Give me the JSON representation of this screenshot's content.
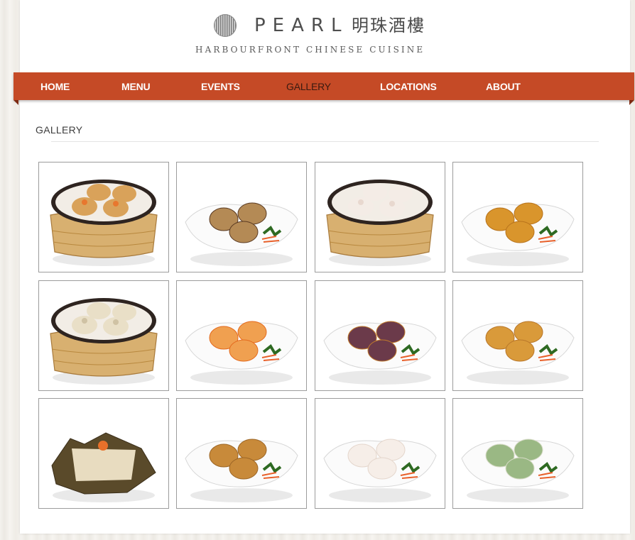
{
  "logo": {
    "name": "PEARL",
    "chinese_name": "明珠酒樓",
    "tagline": "HARBOURFRONT CHINESE CUISINE"
  },
  "nav": {
    "items": [
      {
        "label": "HOME"
      },
      {
        "label": "MENU"
      },
      {
        "label": "EVENTS"
      },
      {
        "label": "GALLERY",
        "active": true
      },
      {
        "label": "LOCATIONS"
      },
      {
        "label": "ABOUT"
      }
    ]
  },
  "gallery": {
    "title": "GALLERY",
    "images": [
      {
        "name": "shrimp-siu-mai-steamer",
        "kind": "steamer"
      },
      {
        "name": "sesame-balls-plate",
        "kind": "plate"
      },
      {
        "name": "har-gow-steamer",
        "kind": "steamer"
      },
      {
        "name": "baked-pastry-plate",
        "kind": "plate"
      },
      {
        "name": "dumplings-steamer",
        "kind": "steamer"
      },
      {
        "name": "shrimp-balls-plate",
        "kind": "plate"
      },
      {
        "name": "stuffed-eggplant-plate",
        "kind": "plate"
      },
      {
        "name": "fried-cakes-plate",
        "kind": "plate"
      },
      {
        "name": "sticky-rice-lotus-leaf",
        "kind": "leaf"
      },
      {
        "name": "tofu-skin-rolls-plate",
        "kind": "plate"
      },
      {
        "name": "rice-noodle-rolls-plate",
        "kind": "plate"
      },
      {
        "name": "vegetable-dumplings-plate",
        "kind": "plate"
      }
    ]
  },
  "colors": {
    "nav_bg": "#c54a26",
    "nav_text": "#ffffff",
    "nav_active_text": "#3a1a10",
    "thumb_border": "#9c9c9c"
  }
}
